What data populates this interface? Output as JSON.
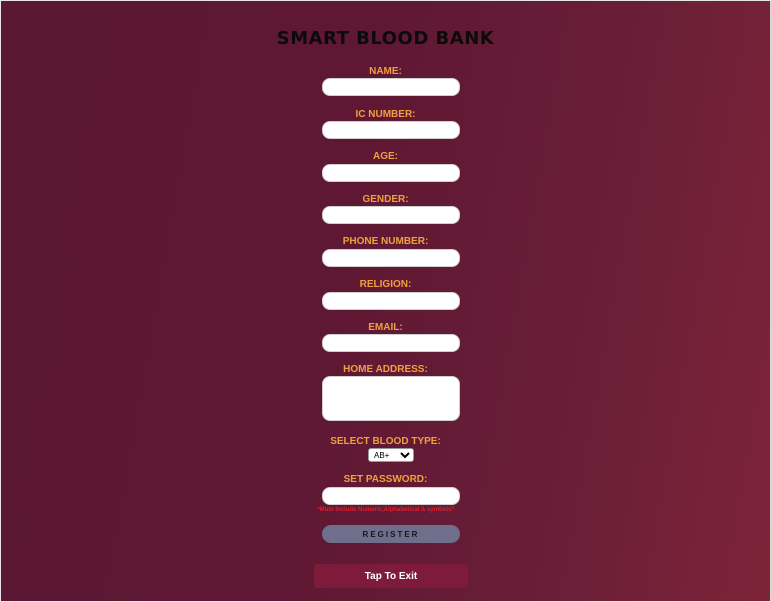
{
  "form": {
    "title": "SMART BLOOD BANK",
    "labels": {
      "name": "NAME:",
      "ic_number": "IC NUMBER:",
      "age": "AGE:",
      "gender": "GENDER:",
      "phone": "PHONE NUMBER:",
      "religion": "RELIGION:",
      "email": "EMAIL:",
      "address": "HOME ADDRESS:",
      "blood_type": "SELECT BLOOD TYPE:",
      "password": "SET PASSWORD:"
    },
    "values": {
      "name": "",
      "ic_number": "",
      "age": "",
      "gender": "",
      "phone": "",
      "religion": "",
      "email": "",
      "address": "",
      "password": ""
    },
    "blood_type_selected": "AB+",
    "password_hint": "*Must Include Numeric,Alphabetical & symbols*",
    "register_label": "REGISTER",
    "exit_label": "Tap To Exit"
  },
  "colors": {
    "label": "#f0a040",
    "hint": "#e0202a",
    "register_bg": "#6f6f8c",
    "exit_bg": "#7f1b3a",
    "background": "#5f1833"
  }
}
